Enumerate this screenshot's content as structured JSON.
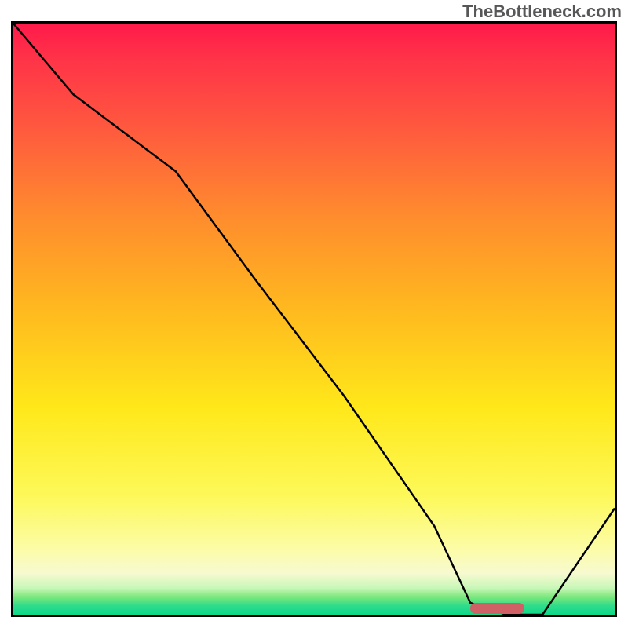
{
  "watermark": "TheBottleneck.com",
  "chart_data": {
    "type": "line",
    "title": "",
    "xlabel": "",
    "ylabel": "",
    "xlim": [
      0,
      100
    ],
    "ylim": [
      0,
      100
    ],
    "x": [
      0,
      10,
      27,
      40,
      55,
      70,
      76,
      82,
      88,
      100
    ],
    "values": [
      100,
      88,
      75,
      57,
      37,
      15,
      2,
      0,
      0,
      18
    ],
    "marker": {
      "x_start": 76,
      "x_end": 85,
      "y": 0.5
    },
    "gradient_stops": [
      {
        "pos": 0,
        "color": "#ff1a4a"
      },
      {
        "pos": 50,
        "color": "#ffc81f"
      },
      {
        "pos": 80,
        "color": "#fdf95a"
      },
      {
        "pos": 100,
        "color": "#0cd989"
      }
    ]
  }
}
